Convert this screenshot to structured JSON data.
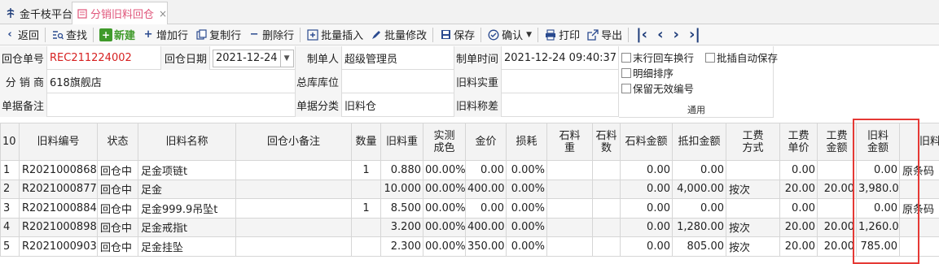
{
  "tabs": {
    "home": "金千枝平台",
    "active": "分销旧料回仓",
    "close": "×"
  },
  "toolbar": {
    "back": "返回",
    "search": "查找",
    "new": "新建",
    "add_row": "增加行",
    "copy_row": "复制行",
    "delete_row": "删除行",
    "batch_insert": "批量插入",
    "batch_edit": "批量修改",
    "save": "保存",
    "confirm": "确认",
    "print": "打印",
    "export": "导出"
  },
  "form": {
    "return_no_label": "回仓单号",
    "return_no": "REC211224002",
    "return_date_label": "回仓日期",
    "return_date": "2021-12-24",
    "creator_label": "制单人",
    "creator": "超级管理员",
    "create_time_label": "制单时间",
    "create_time": "2021-12-24 09:40:37",
    "distributor_label": "分 销 商",
    "distributor": "618旗舰店",
    "warehouse_label": "总库库位",
    "warehouse": "",
    "old_actual_label": "旧料实重",
    "old_actual": "",
    "remark_label": "单据备注",
    "remark": "",
    "category_label": "单据分类",
    "category": "旧料仓",
    "weigh_diff_label": "旧料称差",
    "weigh_diff": ""
  },
  "options": {
    "last_row_enter": "末行回车换行",
    "batch_auto_save": "批插自动保存",
    "detail_sort": "明细排序",
    "keep_invalid_no": "保留无效编号",
    "group": "通用"
  },
  "grid": {
    "row_count": "10",
    "headers": [
      "旧料编号",
      "状态",
      "旧料名称",
      "回仓小备注",
      "数量",
      "旧料重",
      "实测\n成色",
      "金价",
      "损耗",
      "石料\n重",
      "石料\n数",
      "石料金额",
      "抵扣金额",
      "工费\n方式",
      "工费\n单价",
      "工费\n金额",
      "旧料\n金额",
      "旧料"
    ],
    "rows": [
      {
        "idx": "1",
        "code": "R2021000868",
        "status": "回仓中",
        "name": "足金项链t",
        "note": "",
        "qty": "1",
        "weight": "0.880",
        "purity": "00.00%",
        "price": "0.00",
        "loss": "0.00%",
        "stone_w": "",
        "stone_n": "",
        "stone_amt": "0.00",
        "deduct": "0.00",
        "fee_mode": "",
        "fee_unit": "0.00",
        "fee_amt": "",
        "old_amt": "0.00",
        "extra": "原条码"
      },
      {
        "idx": "2",
        "code": "R2021000877",
        "status": "回仓中",
        "name": "足金",
        "note": "",
        "qty": "",
        "weight": "10.000",
        "purity": "00.00%",
        "price": "400.00",
        "loss": "0.00%",
        "stone_w": "",
        "stone_n": "",
        "stone_amt": "0.00",
        "deduct": "4,000.00",
        "fee_mode": "按次",
        "fee_unit": "20.00",
        "fee_amt": "20.00",
        "old_amt": "3,980.00",
        "extra": ""
      },
      {
        "idx": "3",
        "code": "R2021000884",
        "status": "回仓中",
        "name": "足金999.9吊坠t",
        "note": "",
        "qty": "1",
        "weight": "8.500",
        "purity": "00.00%",
        "price": "0.00",
        "loss": "0.00%",
        "stone_w": "",
        "stone_n": "",
        "stone_amt": "0.00",
        "deduct": "0.00",
        "fee_mode": "",
        "fee_unit": "0.00",
        "fee_amt": "",
        "old_amt": "0.00",
        "extra": "原条码"
      },
      {
        "idx": "4",
        "code": "R2021000898",
        "status": "回仓中",
        "name": "足金戒指t",
        "note": "",
        "qty": "",
        "weight": "3.200",
        "purity": "00.00%",
        "price": "400.00",
        "loss": "0.00%",
        "stone_w": "",
        "stone_n": "",
        "stone_amt": "0.00",
        "deduct": "1,280.00",
        "fee_mode": "按次",
        "fee_unit": "20.00",
        "fee_amt": "20.00",
        "old_amt": "1,260.00",
        "extra": ""
      },
      {
        "idx": "5",
        "code": "R2021000903",
        "status": "回仓中",
        "name": "足金挂坠",
        "note": "",
        "qty": "",
        "weight": "2.300",
        "purity": "00.00%",
        "price": "350.00",
        "loss": "0.00%",
        "stone_w": "",
        "stone_n": "",
        "stone_amt": "0.00",
        "deduct": "805.00",
        "fee_mode": "按次",
        "fee_unit": "20.00",
        "fee_amt": "20.00",
        "old_amt": "785.00",
        "extra": ""
      }
    ]
  }
}
